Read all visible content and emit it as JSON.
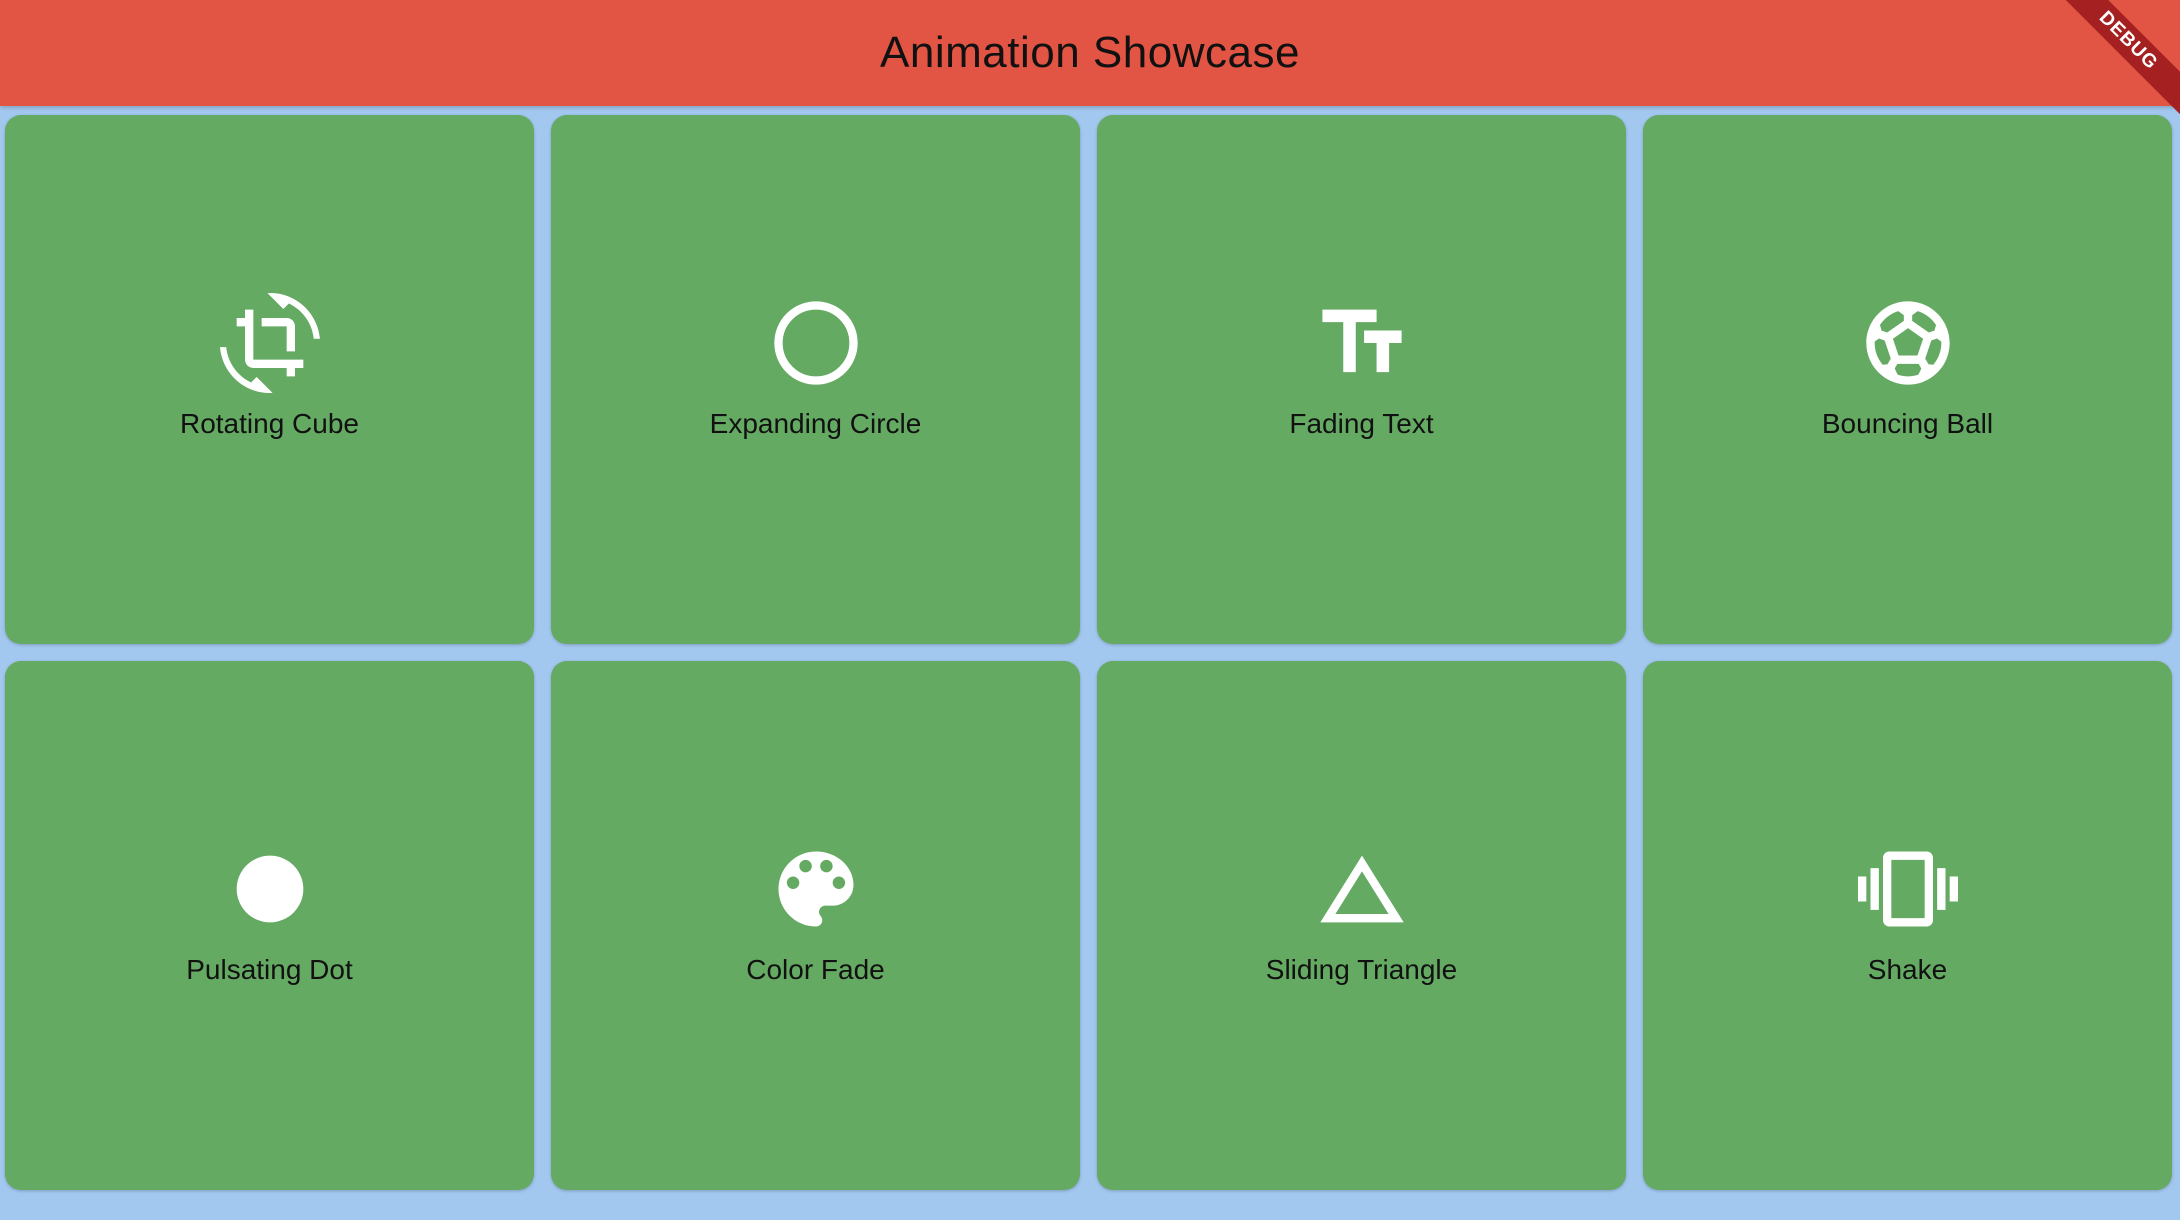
{
  "app": {
    "title": "Animation Showcase",
    "debug_banner": "DEBUG",
    "colors": {
      "app_bar": "#e25443",
      "background": "#a3c8f0",
      "tile": "#65aa63",
      "icon": "#ffffff",
      "debug_banner": "#a52121"
    }
  },
  "tiles": [
    {
      "label": "Rotating Cube",
      "icon": "crop-rotate-icon"
    },
    {
      "label": "Expanding Circle",
      "icon": "circle-outline-icon"
    },
    {
      "label": "Fading Text",
      "icon": "text-fields-icon"
    },
    {
      "label": "Bouncing Ball",
      "icon": "sports-soccer-icon"
    },
    {
      "label": "Pulsating Dot",
      "icon": "filled-circle-icon"
    },
    {
      "label": "Color Fade",
      "icon": "palette-icon"
    },
    {
      "label": "Sliding Triangle",
      "icon": "triangle-outline-icon"
    },
    {
      "label": "Shake",
      "icon": "vibration-icon"
    }
  ]
}
